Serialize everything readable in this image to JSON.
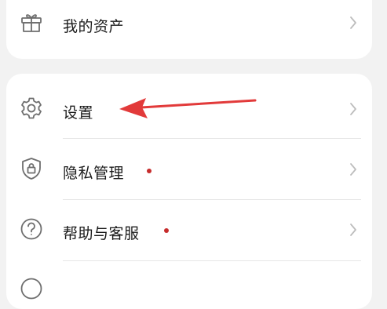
{
  "assets_item": {
    "label": "我的资产",
    "icon": "gift-icon"
  },
  "menu_items": [
    {
      "label": "设置",
      "icon": "gear-icon",
      "has_badge": false
    },
    {
      "label": "隐私管理",
      "icon": "privacy-shield-lock-icon",
      "has_badge": true
    },
    {
      "label": "帮助与客服",
      "icon": "help-question-icon",
      "has_badge": true
    }
  ],
  "colors": {
    "badge": "#c62c2c",
    "arrow": "#e23a3a",
    "background": "#f2f2f2"
  }
}
